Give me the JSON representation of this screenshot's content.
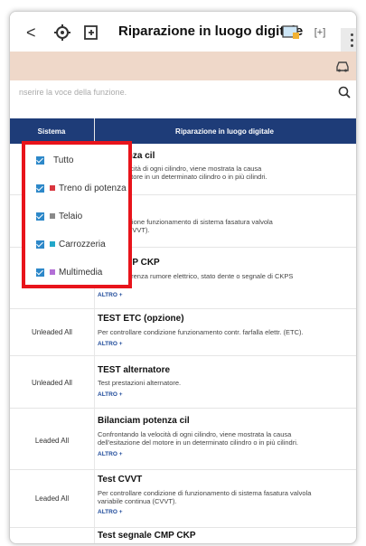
{
  "header": {
    "title": "Riparazione in luogo digitale",
    "back_label": "<",
    "expand_label": "[+]"
  },
  "search": {
    "placeholder": "nserire la voce della funzione."
  },
  "table": {
    "col_system": "Sistema",
    "col_function": "Riparazione in luogo digitale",
    "more_label": "ALTRO +",
    "rows": [
      {
        "system": "",
        "title": "m potenza cil",
        "desc": "ndo la velocità di ogni cilindro, viene mostrata la causa\none del motore in un determinato cilindro o in più cilindri."
      },
      {
        "system": "",
        "title": "T",
        "desc": "llare condizione funzionamento di sistema fasatura valvola\ncontinua (CVVT)."
      },
      {
        "system": "",
        "title": "nale CMP CKP",
        "desc": "llare interferenza rumore elettrico, stato dente o segnale di CKPS\no CMPS."
      },
      {
        "system": "Unleaded All",
        "title": "TEST ETC (opzione)",
        "desc": "Per controllare condizione funzionamento contr. farfalla elettr. (ETC)."
      },
      {
        "system": "Unleaded All",
        "title": "TEST alternatore",
        "desc": "Test prestazioni alternatore."
      },
      {
        "system": "Leaded All",
        "title": "Bilanciam potenza cil",
        "desc": "Confrontando la velocità di ogni cilindro, viene mostrata la causa\ndell'esitazione del motore in un determinato cilindro o in più cilindri."
      },
      {
        "system": "Leaded All",
        "title": "Test CVVT",
        "desc": "Per controllare condizione di funzionamento di sistema fasatura valvola\nvariabile continua (CVVT)."
      },
      {
        "system": "",
        "title": "Test segnale CMP CKP",
        "desc": ""
      }
    ]
  },
  "filter": {
    "options": [
      {
        "label": "Tutto",
        "color": ""
      },
      {
        "label": "Treno di potenza",
        "color": "#d9363e"
      },
      {
        "label": "Telaio",
        "color": "#8a8a8a"
      },
      {
        "label": "Carrozzeria",
        "color": "#22a7c9"
      },
      {
        "label": "Multimedia",
        "color": "#b36fd6"
      }
    ]
  },
  "colors": {
    "header_band": "#efd8c9",
    "table_header": "#1e3c78",
    "highlight": "#e8141b",
    "checkbox": "#2d88c9"
  }
}
